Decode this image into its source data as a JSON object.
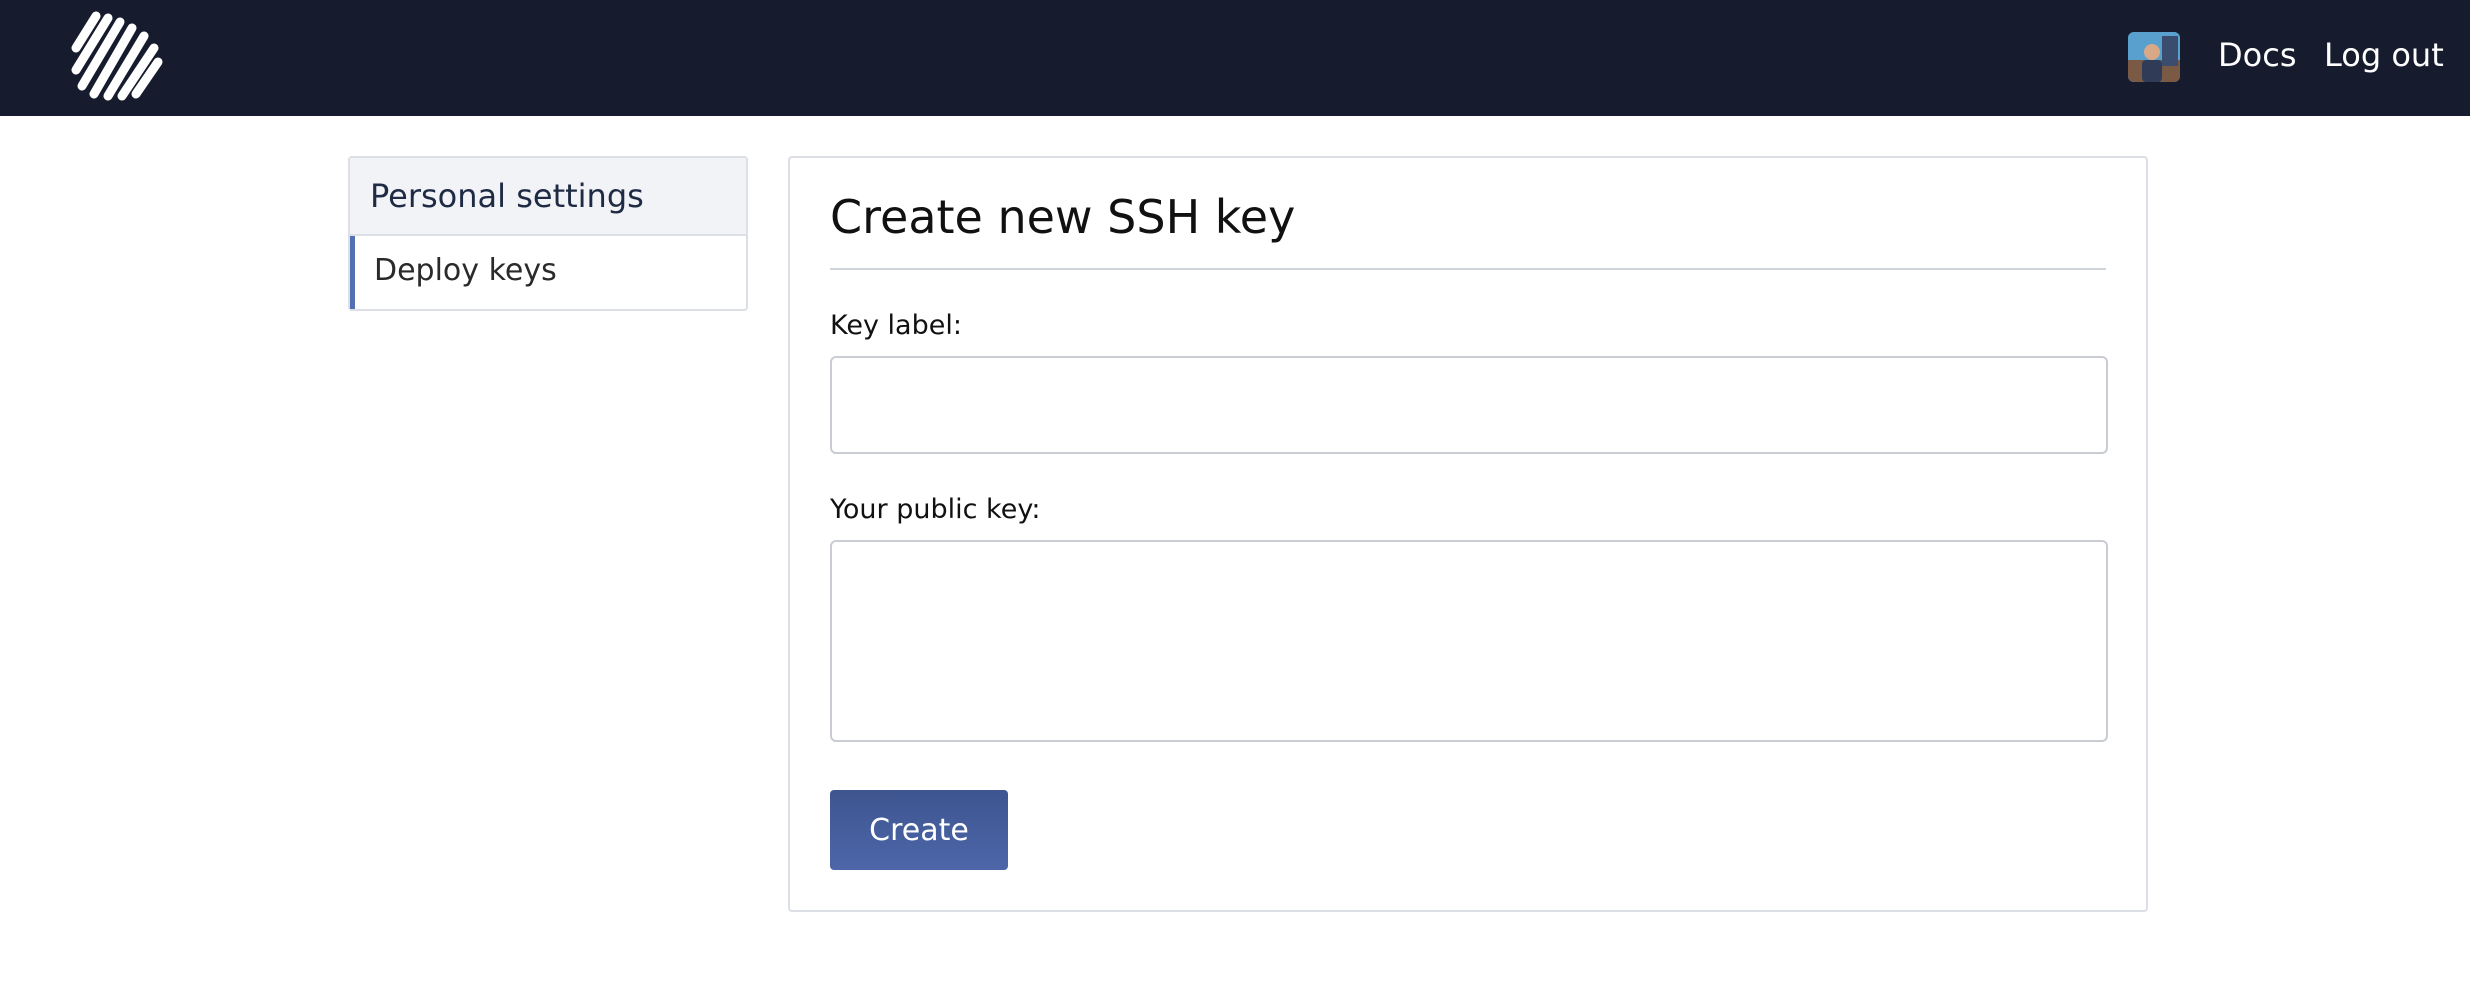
{
  "header": {
    "logo_icon": "striped-logo-icon",
    "avatar_icon": "user-avatar",
    "links": {
      "docs": "Docs",
      "logout": "Log out"
    },
    "background_color": "#161c2e"
  },
  "sidebar": {
    "heading": "Personal settings",
    "items": [
      {
        "label": "Deploy keys",
        "active": true
      }
    ],
    "accent_color": "#5370b3"
  },
  "form": {
    "title": "Create new SSH key",
    "key_label_label": "Key label:",
    "key_label_value": "",
    "public_key_label": "Your public key:",
    "public_key_value": "",
    "submit_label": "Create",
    "button_color": "#4660a0"
  }
}
